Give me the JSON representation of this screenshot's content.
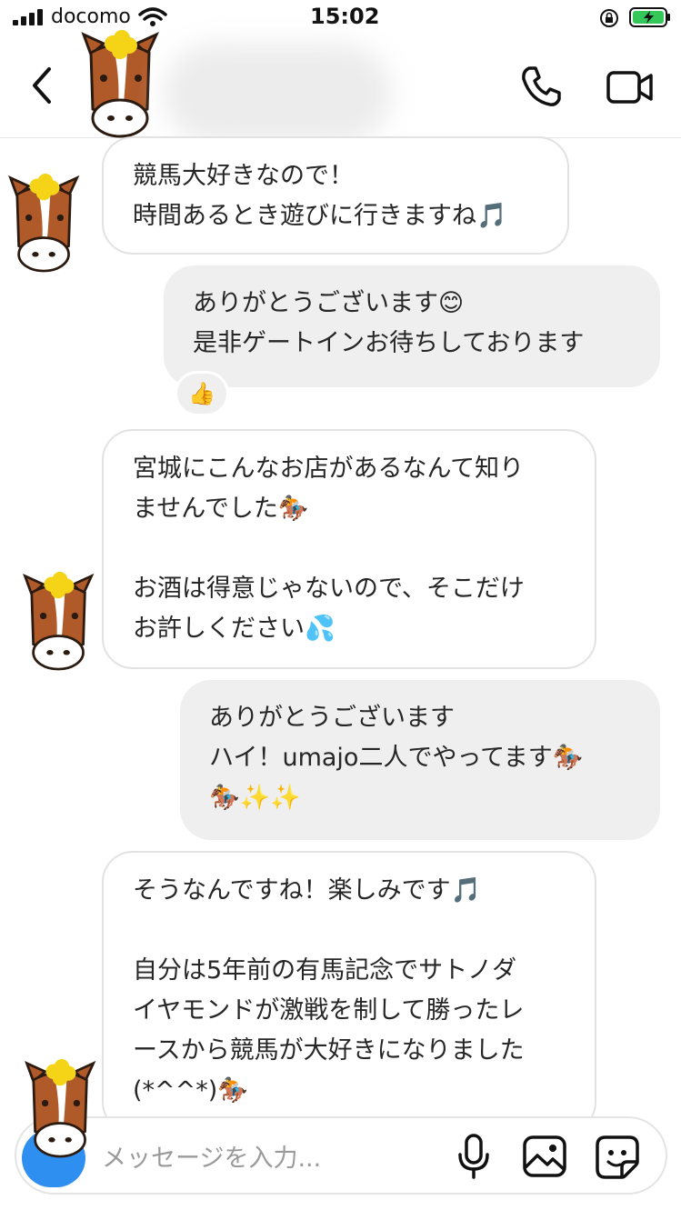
{
  "status_bar": {
    "carrier": "docomo",
    "time": "15:02"
  },
  "header": {
    "back_icon": "chevron-left-icon",
    "call_icon": "phone-icon",
    "video_icon": "video-camera-icon"
  },
  "messages": [
    {
      "from": "them",
      "text": "競馬大好きなので！\n時間あるとき遊びに行きますね🎵"
    },
    {
      "from": "me",
      "text": "ありがとうございます😊\n是非ゲートインお待ちしております",
      "reaction": "👍"
    },
    {
      "from": "them",
      "text": "宮城にこんなお店があるなんて知り\nませんでした🏇\n\nお酒は得意じゃないので、そこだけ\nお許しください💦"
    },
    {
      "from": "me",
      "text": "ありがとうございます\nハイ！umajo二人でやってます🏇\n🏇✨✨"
    },
    {
      "from": "them",
      "text": "そうなんですね！楽しみです🎵\n\n自分は5年前の有馬記念でサトノダ\nイヤモンドが激戦を制して勝ったレ\nースから競馬が大好きになりました\n(*^^*)🏇"
    }
  ],
  "composer": {
    "placeholder": "メッセージを入力...",
    "camera_icon": "camera-icon",
    "mic_icon": "microphone-icon",
    "gallery_icon": "image-icon",
    "sticker_icon": "sticker-icon"
  },
  "colors": {
    "outgoing_bubble": "#efefef",
    "incoming_border": "#e2e2e2",
    "camera_button": "#2e8ff0",
    "battery_green": "#34c759"
  }
}
